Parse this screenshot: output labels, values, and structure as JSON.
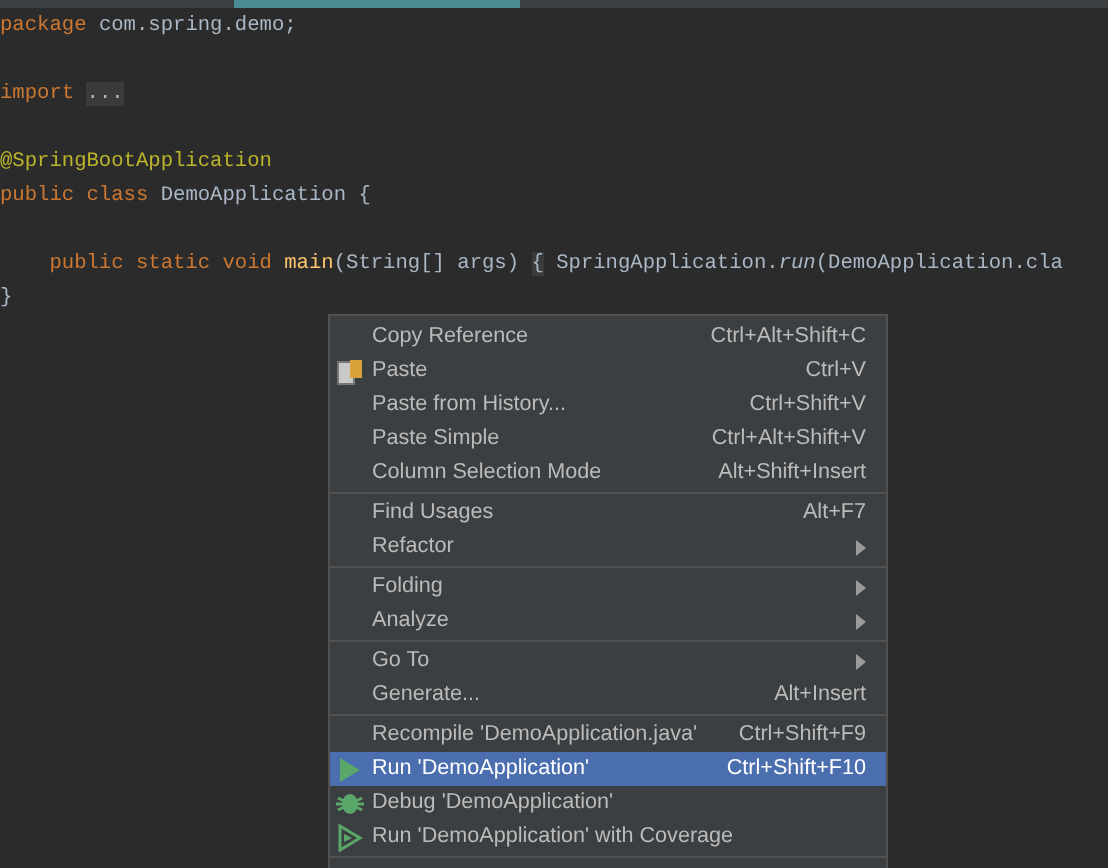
{
  "editor": {
    "blocks": [
      [
        [
          {
            "kind": "keyword",
            "text": "package"
          },
          {
            "kind": "plain",
            "text": " com.spring.demo;"
          }
        ]
      ],
      [
        [
          {
            "kind": "keyword",
            "text": "import "
          },
          {
            "kind": "fold",
            "text": "..."
          }
        ]
      ],
      [
        [
          {
            "kind": "annotation",
            "text": "@SpringBootApplication"
          }
        ],
        [
          {
            "kind": "keyword",
            "text": "public class"
          },
          {
            "kind": "plain",
            "text": " DemoApplication {"
          }
        ]
      ],
      [
        [
          {
            "kind": "keyword",
            "text": "    public static void "
          },
          {
            "kind": "method",
            "text": "main"
          },
          {
            "kind": "plain",
            "text": "(String[] args) "
          },
          {
            "kind": "fold",
            "text": "{"
          },
          {
            "kind": "plain",
            "text": " SpringApplication."
          },
          {
            "kind": "italic",
            "text": "run"
          },
          {
            "kind": "plain",
            "text": "(DemoApplication.cla"
          }
        ],
        [
          {
            "kind": "plain",
            "text": "}"
          }
        ]
      ]
    ]
  },
  "context_menu": {
    "groups": [
      [
        {
          "kind": "plain",
          "label": "Copy Reference",
          "shortcut": "Ctrl+Alt+Shift+C",
          "submenu": false,
          "selected": false
        },
        {
          "kind": "paste",
          "label": "Paste",
          "shortcut": "Ctrl+V",
          "submenu": false,
          "selected": false
        },
        {
          "kind": "plain",
          "label": "Paste from History...",
          "shortcut": "Ctrl+Shift+V",
          "submenu": false,
          "selected": false
        },
        {
          "kind": "plain",
          "label": "Paste Simple",
          "shortcut": "Ctrl+Alt+Shift+V",
          "submenu": false,
          "selected": false
        },
        {
          "kind": "plain",
          "label": "Column Selection Mode",
          "shortcut": "Alt+Shift+Insert",
          "submenu": false,
          "selected": false
        }
      ],
      [
        {
          "kind": "plain",
          "label": "Find Usages",
          "shortcut": "Alt+F7",
          "submenu": false,
          "selected": false
        },
        {
          "kind": "plain",
          "label": "Refactor",
          "submenu": true,
          "selected": false
        }
      ],
      [
        {
          "kind": "plain",
          "label": "Folding",
          "submenu": true,
          "selected": false
        },
        {
          "kind": "plain",
          "label": "Analyze",
          "submenu": true,
          "selected": false
        }
      ],
      [
        {
          "kind": "plain",
          "label": "Go To",
          "submenu": true,
          "selected": false
        },
        {
          "kind": "plain",
          "label": "Generate...",
          "shortcut": "Alt+Insert",
          "submenu": false,
          "selected": false
        }
      ],
      [
        {
          "kind": "plain",
          "label": "Recompile 'DemoApplication.java'",
          "shortcut": "Ctrl+Shift+F9",
          "submenu": false,
          "selected": false
        },
        {
          "kind": "run",
          "label": "Run 'DemoApplication'",
          "shortcut": "Ctrl+Shift+F10",
          "submenu": false,
          "selected": true
        },
        {
          "kind": "debug",
          "label": "Debug 'DemoApplication'",
          "submenu": false,
          "selected": false
        },
        {
          "kind": "coverage",
          "label": "Run 'DemoApplication' with Coverage",
          "submenu": false,
          "selected": false
        }
      ]
    ]
  }
}
